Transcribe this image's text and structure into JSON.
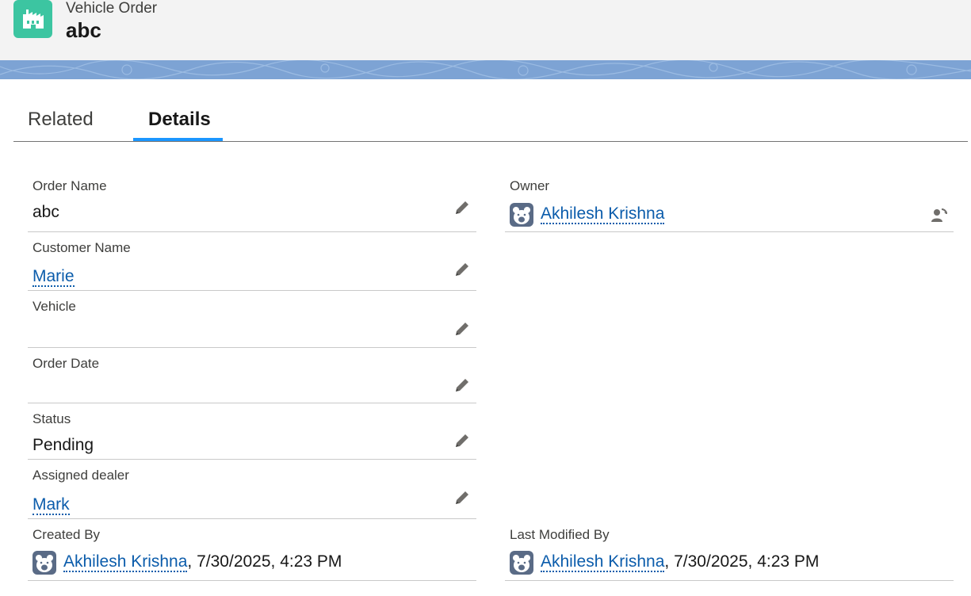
{
  "header": {
    "object_type": "Vehicle Order",
    "record_name": "abc",
    "icon": "factory-icon",
    "icon_color": "#3cc5a1"
  },
  "banner": {
    "color": "#7da3d4"
  },
  "tabs": [
    {
      "label": "Related",
      "active": false
    },
    {
      "label": "Details",
      "active": true
    }
  ],
  "accent_color": "#1b96ff",
  "link_color": "#0b5cab",
  "fields": {
    "order_name": {
      "label": "Order Name",
      "value": "abc"
    },
    "customer_name": {
      "label": "Customer Name",
      "value": "Marie"
    },
    "vehicle": {
      "label": "Vehicle",
      "value": ""
    },
    "order_date": {
      "label": "Order Date",
      "value": ""
    },
    "status": {
      "label": "Status",
      "value": "Pending"
    },
    "assigned_dealer": {
      "label": "Assigned dealer",
      "value": "Mark"
    },
    "owner": {
      "label": "Owner",
      "value": "Akhilesh Krishna"
    },
    "created_by": {
      "label": "Created By",
      "user": "Akhilesh Krishna",
      "separator": ",",
      "datetime": "7/30/2025, 4:23 PM"
    },
    "last_modified_by": {
      "label": "Last Modified By",
      "user": "Akhilesh Krishna",
      "separator": ",",
      "datetime": "7/30/2025, 4:23 PM"
    }
  },
  "icons": {
    "edit": "pencil-icon",
    "change_owner": "change-owner-icon",
    "avatar": "bear-avatar-icon"
  }
}
